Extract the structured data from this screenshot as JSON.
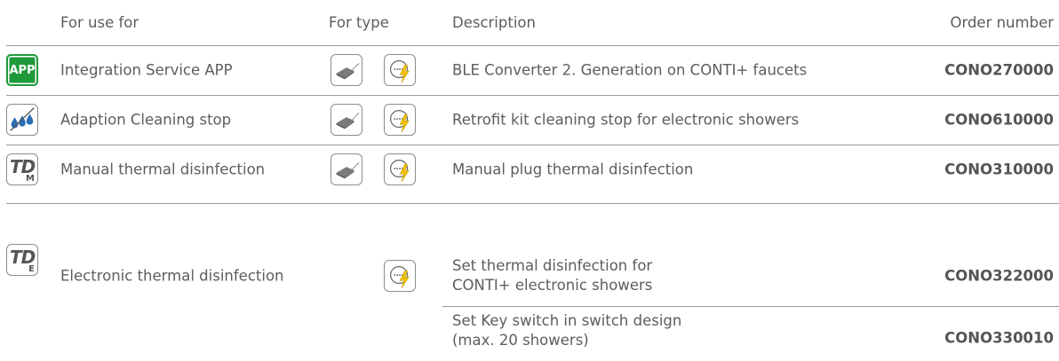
{
  "headers": {
    "use": "For use for",
    "type": "For type",
    "description": "Description",
    "order": "Order number"
  },
  "rows": [
    {
      "icon": "app-icon",
      "icon_text": "APP",
      "use": "Integration Service APP",
      "types": [
        "battery-module-icon",
        "mains-power-icon"
      ],
      "description": "BLE Converter 2. Generation on CONTI+ faucets",
      "order": "CONO270000"
    },
    {
      "icon": "cleaning-stop-icon",
      "use": "Adaption Cleaning stop",
      "types": [
        "battery-module-icon",
        "mains-power-icon"
      ],
      "description": "Retrofit kit cleaning stop for electronic showers",
      "order": "CONO610000"
    },
    {
      "icon": "td-manual-icon",
      "icon_text": "TD",
      "icon_sub": "M",
      "use": "Manual thermal disinfection",
      "types": [
        "battery-module-icon",
        "mains-power-icon"
      ],
      "description": "Manual plug thermal disinfection",
      "order": "CONO310000"
    },
    {
      "icon": "td-electronic-icon",
      "icon_text": "TD",
      "icon_sub": "E",
      "use": "Electronic thermal disinfection",
      "types": [
        "mains-power-icon"
      ],
      "description_lines": [
        "Set thermal disinfection for",
        "CONTI+ electronic showers"
      ],
      "order": "CONO322000"
    },
    {
      "description_lines": [
        "Set Key switch in switch design",
        "(max. 20 showers)"
      ],
      "order": "CONO330010"
    }
  ],
  "colors": {
    "app_green": "#1f9a3a",
    "text_gray": "#5d5d5d",
    "line_gray": "#9a9a9a",
    "lightning_yellow": "#f2c200",
    "water_blue": "#2a6fb5"
  }
}
